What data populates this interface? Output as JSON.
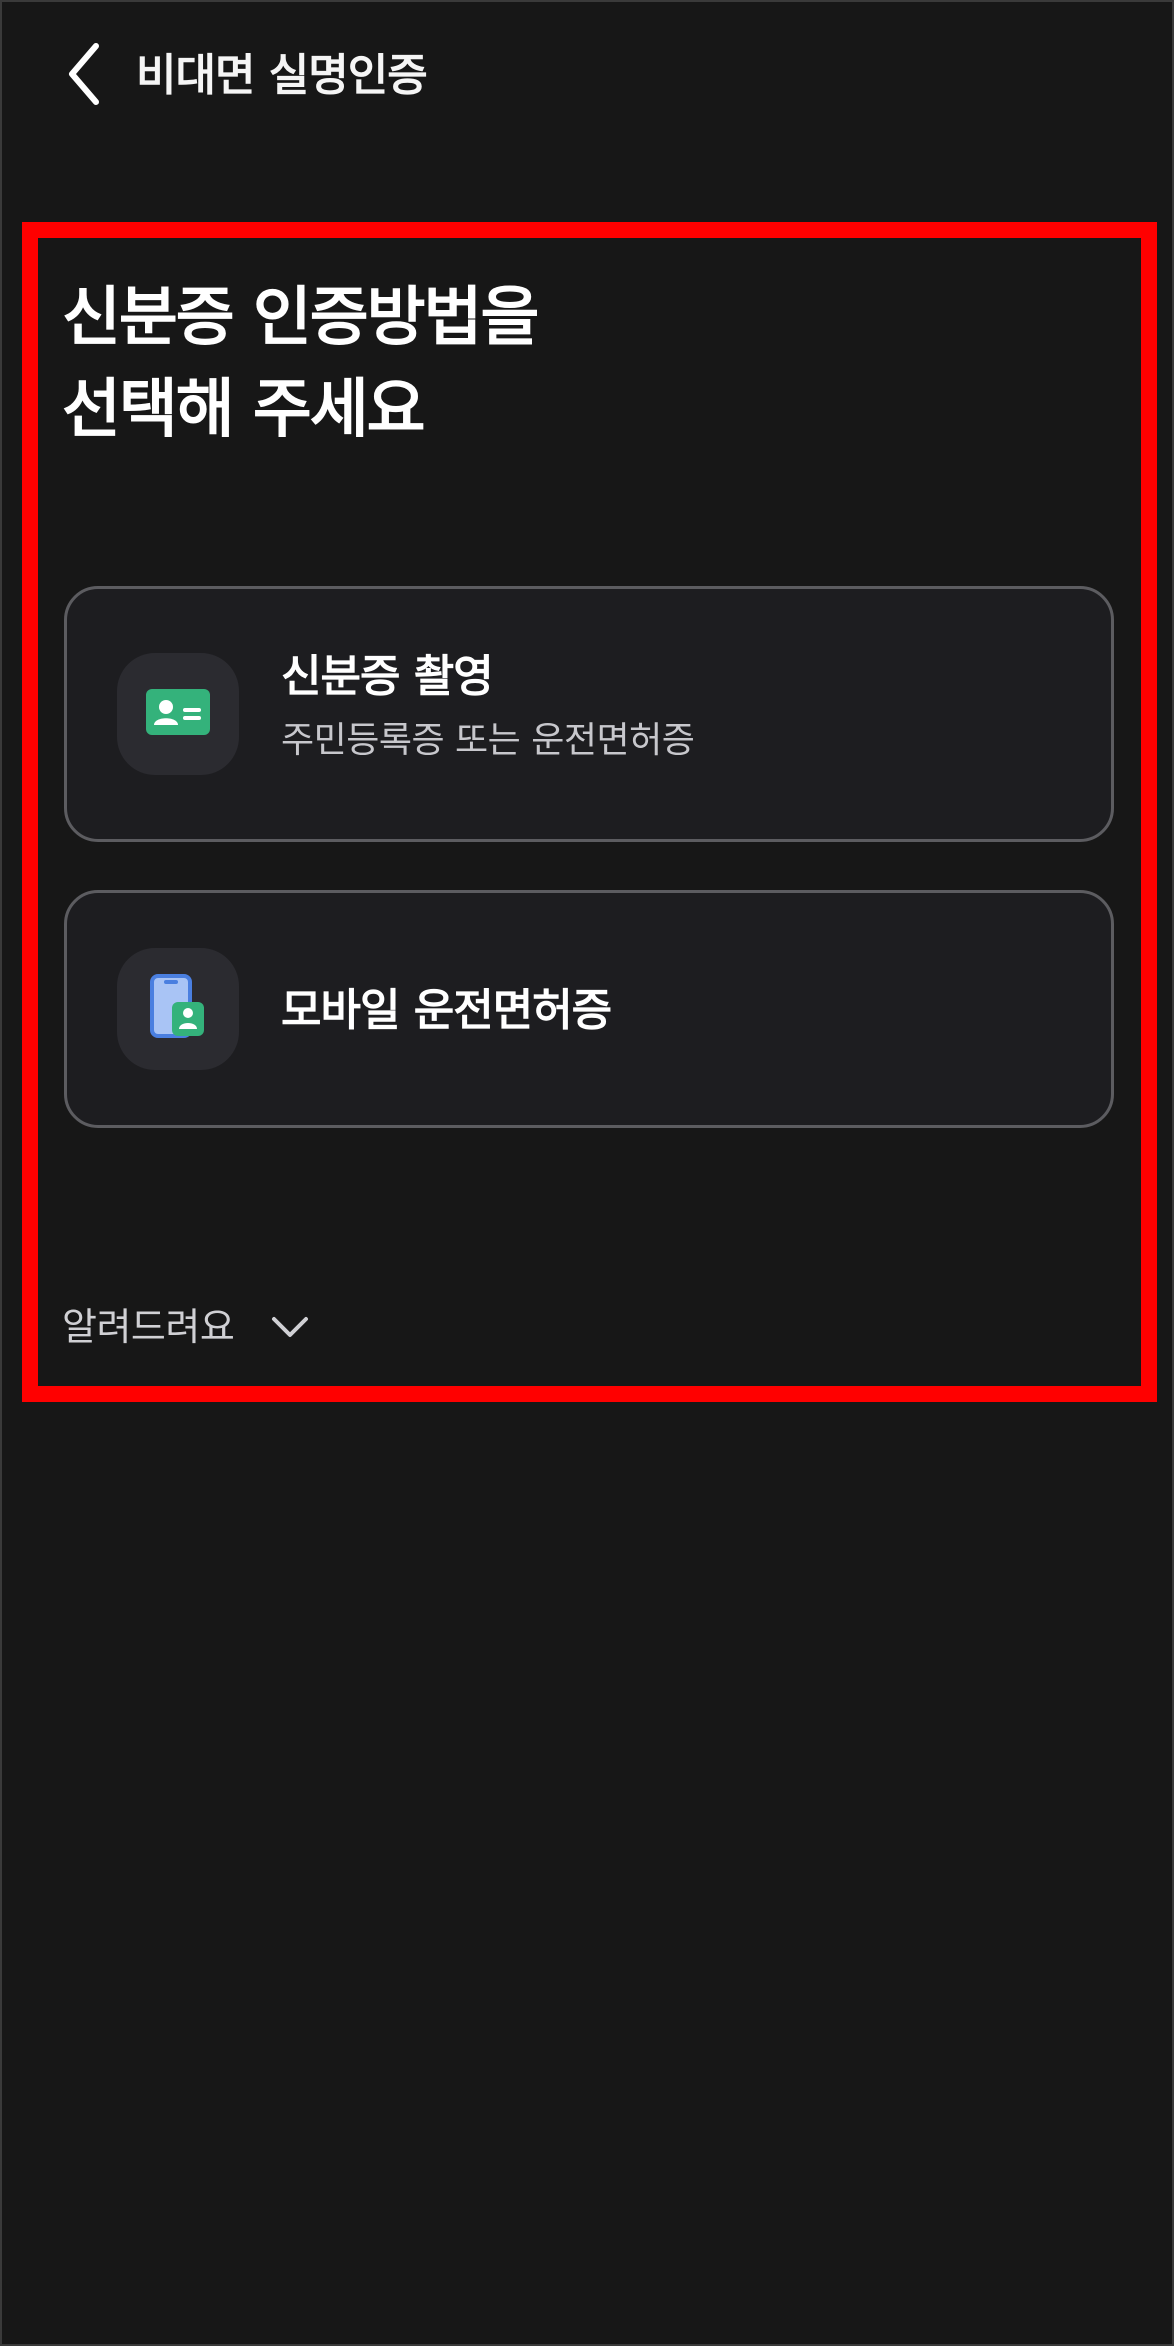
{
  "header": {
    "back_icon": "chevron-left-icon",
    "title": "비대면 실명인증"
  },
  "main": {
    "title_lines": [
      "신분증 인증방법을",
      "선택해 주세요"
    ],
    "options": [
      {
        "icon": "id-card-icon",
        "label": "신분증 촬영",
        "sub": "주민등록증 또는 운전면허증"
      },
      {
        "icon": "mobile-license-icon",
        "label": "모바일 운전면허증"
      }
    ],
    "notice": {
      "label": "알려드려요",
      "icon": "chevron-down-icon"
    }
  },
  "colors": {
    "background": "#171717",
    "card_background": "#1d1d20",
    "card_border": "#5c5c60",
    "highlight": "#ff0000",
    "accent_green": "#34b27b",
    "accent_blue": "#4a7fe0"
  }
}
